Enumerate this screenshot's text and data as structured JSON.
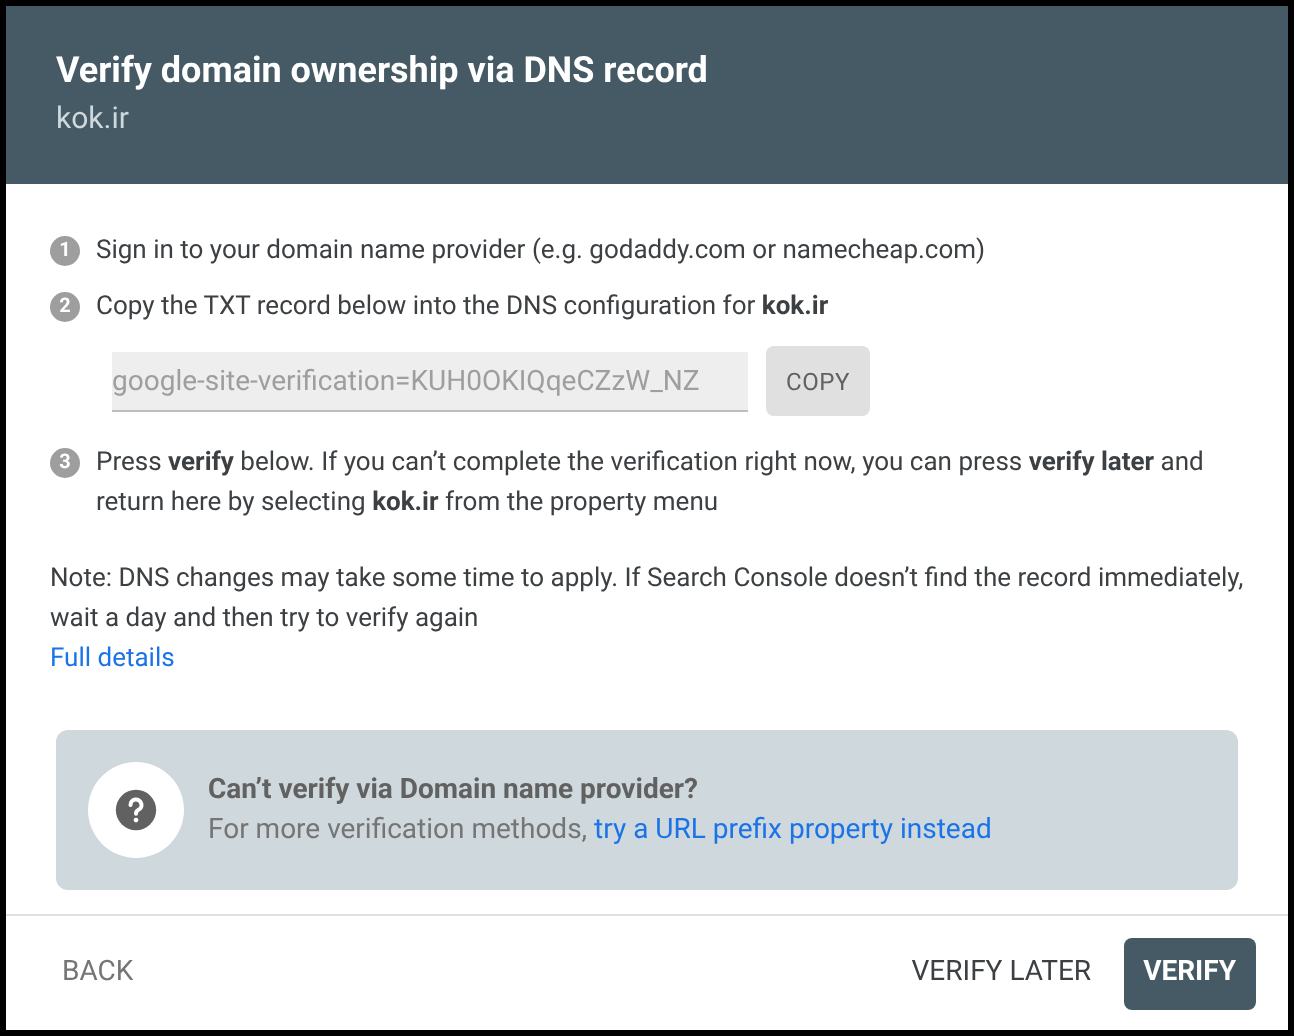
{
  "dialog": {
    "title": "Verify domain ownership via DNS record",
    "subtitle": "kok.ir"
  },
  "steps": [
    {
      "number": "1",
      "text": "Sign in to your domain name provider (e.g. godaddy.com or namecheap.com)"
    },
    {
      "number": "2",
      "text": "Copy the TXT record below into the DNS configuration for **kok.ir**",
      "record": {
        "value": "google-site-verification=KUH0OKIQqeCZzW_NZ",
        "button": "COPY"
      }
    },
    {
      "number": "3",
      "text": "Press **verify** below. If you can’t complete the verification right now, you can press **verify later** and return here by selecting **kok.ir** from the property menu"
    }
  ],
  "note": "Note: DNS changes may take some time to apply. If Search Console doesn’t find the record immediately, wait a day and then try to verify again",
  "details_link": "Full details",
  "help": {
    "title": "Can’t verify via Domain name provider?",
    "text": "For more verification methods,",
    "link": "try a URL prefix property instead"
  },
  "footer": {
    "back": "BACK",
    "verify_later": "VERIFY LATER",
    "verify": "VERIFY"
  }
}
